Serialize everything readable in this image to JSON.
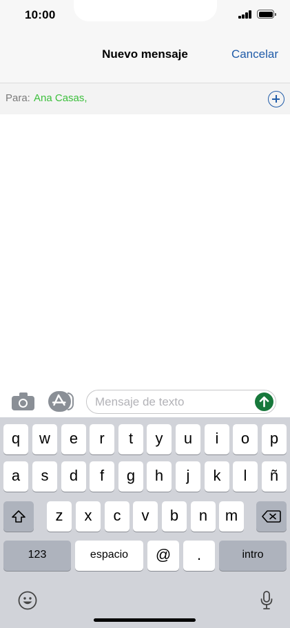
{
  "status_bar": {
    "time": "10:00"
  },
  "nav": {
    "title": "Nuevo mensaje",
    "cancel_label": "Cancelar"
  },
  "recipient": {
    "label": "Para:",
    "value": "Ana Casas,"
  },
  "compose": {
    "placeholder": "Mensaje de texto"
  },
  "keyboard": {
    "row1": [
      "q",
      "w",
      "e",
      "r",
      "t",
      "y",
      "u",
      "i",
      "o",
      "p"
    ],
    "row2": [
      "a",
      "s",
      "d",
      "f",
      "g",
      "h",
      "j",
      "k",
      "l",
      "ñ"
    ],
    "row3": [
      "z",
      "x",
      "c",
      "v",
      "b",
      "n",
      "m"
    ],
    "numbers_label": "123",
    "space_label": "espacio",
    "at_label": "@",
    "dot_label": ".",
    "return_label": "intro"
  },
  "colors": {
    "accent": "#1f5ba8",
    "recipient_green": "#3bbf3b",
    "send_green": "#17783b",
    "keyboard_bg": "#d1d3d9"
  },
  "icons": [
    "signal-icon",
    "battery-icon",
    "add-contact-icon",
    "camera-icon",
    "app-store-icon",
    "send-arrow-icon",
    "shift-icon",
    "backspace-icon",
    "emoji-icon",
    "microphone-icon"
  ]
}
